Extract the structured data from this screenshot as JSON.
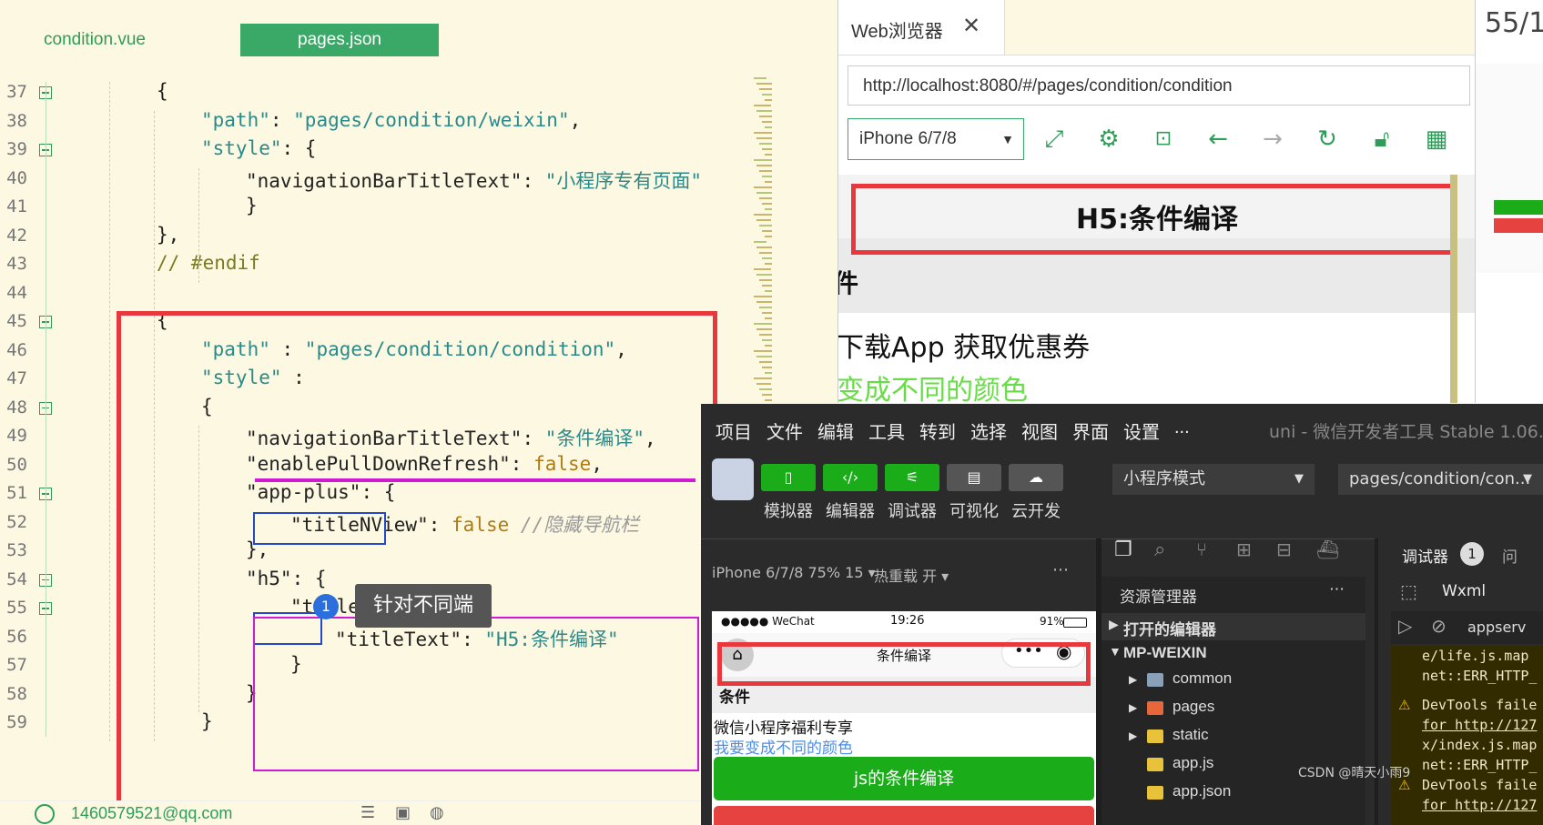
{
  "editor": {
    "tabs": [
      "condition.vue",
      "pages.json"
    ],
    "lines": [
      {
        "n": "37",
        "fold": true,
        "indent": 1,
        "tokens": [
          {
            "t": "{",
            "c": "p"
          }
        ]
      },
      {
        "n": "38",
        "fold": false,
        "indent": 2,
        "tokens": [
          {
            "t": "\"path\"",
            "c": "s"
          },
          {
            "t": ": ",
            "c": "p"
          },
          {
            "t": "\"pages/condition/weixin\"",
            "c": "s"
          },
          {
            "t": ",",
            "c": "p"
          }
        ]
      },
      {
        "n": "39",
        "fold": true,
        "indent": 2,
        "tokens": [
          {
            "t": "\"style\"",
            "c": "s"
          },
          {
            "t": ": {",
            "c": "p"
          }
        ]
      },
      {
        "n": "40",
        "fold": false,
        "indent": 3,
        "tokens": [
          {
            "t": "\"navigationBarTitleText\"",
            "c": "p"
          },
          {
            "t": ": ",
            "c": "p"
          },
          {
            "t": "\"小程序专有页面\"",
            "c": "s"
          }
        ]
      },
      {
        "n": "41",
        "fold": false,
        "indent": 3,
        "tokens": [
          {
            "t": "}",
            "c": "p"
          }
        ]
      },
      {
        "n": "42",
        "fold": false,
        "indent": 1,
        "tokens": [
          {
            "t": "},",
            "c": "p"
          }
        ]
      },
      {
        "n": "43",
        "fold": false,
        "indent": 1,
        "tokens": [
          {
            "t": "// #endif",
            "c": "k"
          }
        ]
      },
      {
        "n": "44",
        "fold": false,
        "indent": 1,
        "tokens": []
      },
      {
        "n": "45",
        "fold": true,
        "indent": 1,
        "tokens": [
          {
            "t": "{",
            "c": "p"
          }
        ]
      },
      {
        "n": "46",
        "fold": false,
        "indent": 2,
        "tokens": [
          {
            "t": "\"path\"",
            "c": "s"
          },
          {
            "t": " : ",
            "c": "p"
          },
          {
            "t": "\"pages/condition/condition\"",
            "c": "s"
          },
          {
            "t": ",",
            "c": "p"
          }
        ]
      },
      {
        "n": "47",
        "fold": false,
        "indent": 2,
        "tokens": [
          {
            "t": "\"style\"",
            "c": "s"
          },
          {
            "t": " :",
            "c": "p"
          }
        ]
      },
      {
        "n": "48",
        "fold": true,
        "indent": 2,
        "tokens": [
          {
            "t": "{",
            "c": "p"
          }
        ]
      },
      {
        "n": "49",
        "fold": false,
        "indent": 3,
        "tokens": [
          {
            "t": "\"navigationBarTitleText\"",
            "c": "p"
          },
          {
            "t": ": ",
            "c": "p"
          },
          {
            "t": "\"条件编译\"",
            "c": "s"
          },
          {
            "t": ",",
            "c": "p"
          }
        ]
      },
      {
        "n": "50",
        "fold": false,
        "indent": 3,
        "tokens": [
          {
            "t": "\"enablePullDownRefresh\"",
            "c": "p"
          },
          {
            "t": ": ",
            "c": "p"
          },
          {
            "t": "false",
            "c": "b"
          },
          {
            "t": ",",
            "c": "p"
          }
        ]
      },
      {
        "n": "51",
        "fold": true,
        "indent": 3,
        "tokens": [
          {
            "t": "\"app-plus\"",
            "c": "p"
          },
          {
            "t": ": {",
            "c": "p"
          }
        ]
      },
      {
        "n": "52",
        "fold": false,
        "indent": 4,
        "tokens": [
          {
            "t": "\"titleNView\"",
            "c": "p"
          },
          {
            "t": ": ",
            "c": "p"
          },
          {
            "t": "false",
            "c": "b"
          },
          {
            "t": " //隐藏导航栏",
            "c": "c"
          }
        ]
      },
      {
        "n": "53",
        "fold": false,
        "indent": 3,
        "tokens": [
          {
            "t": "},",
            "c": "p"
          }
        ]
      },
      {
        "n": "54",
        "fold": true,
        "indent": 3,
        "tokens": [
          {
            "t": "\"h5\"",
            "c": "p"
          },
          {
            "t": ": {",
            "c": "p"
          }
        ]
      },
      {
        "n": "55",
        "fold": true,
        "indent": 4,
        "tokens": [
          {
            "t": "\"titleNView\"",
            "c": "p"
          },
          {
            "t": ": {",
            "c": "p"
          }
        ]
      },
      {
        "n": "56",
        "fold": false,
        "indent": 5,
        "tokens": [
          {
            "t": "\"titleText\"",
            "c": "p"
          },
          {
            "t": ": ",
            "c": "p"
          },
          {
            "t": "\"H5:条件编译\"",
            "c": "s"
          }
        ]
      },
      {
        "n": "57",
        "fold": false,
        "indent": 4,
        "tokens": [
          {
            "t": "}",
            "c": "p"
          }
        ]
      },
      {
        "n": "58",
        "fold": false,
        "indent": 3,
        "tokens": [
          {
            "t": "}",
            "c": "p"
          }
        ]
      },
      {
        "n": "59",
        "fold": false,
        "indent": 2,
        "tokens": [
          {
            "t": "}",
            "c": "p"
          }
        ]
      }
    ],
    "tooltip": {
      "badge": "1",
      "text": "针对不同端"
    },
    "status_user": "1460579521@qq.com"
  },
  "browser": {
    "tab_title": "Web浏览器",
    "url": "http://localhost:8080/#/pages/condition/condition",
    "device": "iPhone 6/7/8",
    "page_title": "H5:条件编译",
    "heading_partial": "件",
    "line1": "下载App 获取优惠券",
    "line2": "变成不同的颜色"
  },
  "side_fragment": "55/1",
  "wx": {
    "menu": [
      "项目",
      "文件",
      "编辑",
      "工具",
      "转到",
      "选择",
      "视图",
      "界面",
      "设置",
      "..."
    ],
    "app_title": "uni - 微信开发者工具 Stable 1.06.221",
    "tools": [
      "模拟器",
      "编辑器",
      "调试器",
      "可视化",
      "云开发"
    ],
    "mode": "小程序模式",
    "page_path": "pages/condition/con...",
    "sim_device": "iPhone 6/7/8 75% 15 ▾",
    "hot_reload": "热重载 开 ▾",
    "phone": {
      "carrier": "●●●●● WeChat",
      "time": "19:26",
      "battery": "91%",
      "nav_title": "条件编译",
      "section": "条件",
      "text1": "微信小程序福利专享",
      "text2": "我要变成不同的颜色",
      "button": "js的条件编译"
    },
    "explorer": {
      "title": "资源管理器",
      "open_editors": "打开的编辑器",
      "project": "MP-WEIXIN",
      "items": [
        "common",
        "pages",
        "static",
        "app.js",
        "app.json"
      ]
    },
    "debugger": {
      "tab": "调试器",
      "count": "1",
      "tab2": "问",
      "sub_tab": "Wxml",
      "filter": "appserv",
      "logs": [
        "e/life.js.map",
        "net::ERR_HTTP_",
        "DevTools faile",
        "for http://127",
        "x/index.js.map",
        "net::ERR_HTTP_",
        "DevTools faile",
        "for http://127"
      ]
    },
    "watermark": "CSDN @晴天小雨9"
  },
  "colors": {
    "accent": "#3aa866",
    "red": "#e8383d",
    "blue": "#2548c8",
    "magenta": "#d21ad2"
  }
}
